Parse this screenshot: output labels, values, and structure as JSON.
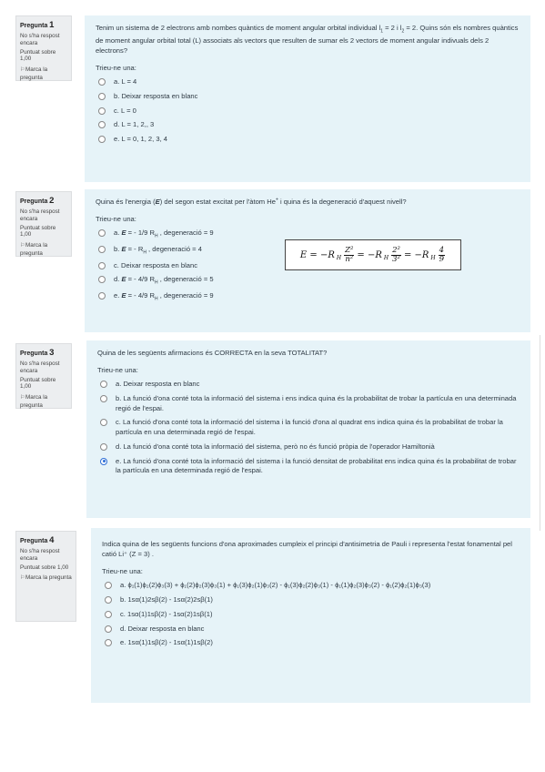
{
  "sidebar_common": {
    "state": "No s'ha respost encara",
    "score": "Puntuat sobre 1,00",
    "flag": "Marca la pregunta",
    "flag_icon": "flag-icon"
  },
  "questions": [
    {
      "label": "Pregunta",
      "number": "1",
      "text_parts": [
        "Tenim un sistema de 2 electrons amb nombes quàntics de moment angular orbital individual l",
        "1",
        " = 2 i l",
        "2",
        " = 2. Quins són els nombres quàntics de moment angular orbital total (L) associats als vectors que resulten de sumar els 2 vectors de moment angular indivuals dels 2 electrons?"
      ],
      "prompt": "Trieu-ne una:",
      "options": [
        "a. L = 4",
        "b. Deixar resposta en blanc",
        "c. L = 0",
        "d. L = 1, 2,, 3",
        "e. L = 0, 1, 2, 3, 4"
      ],
      "selected": null
    },
    {
      "label": "Pregunta",
      "number": "2",
      "text_parts": [
        "Quina és l'energia (",
        "E",
        ") del segon estat excitat per l'àtom He",
        "+",
        " i quina és la degeneració d'aquest nivell?"
      ],
      "prompt": "Trieu-ne una:",
      "options": [
        [
          "a. ",
          "E",
          " = - 1/9 R",
          "H",
          " , degeneració = 9"
        ],
        [
          "b. ",
          "E",
          " = - R",
          "H",
          " , degeneració = 4"
        ],
        [
          "c. Deixar resposta en blanc"
        ],
        [
          "d. ",
          "E",
          " = - 4/9 R",
          "H",
          " , degeneració = 5"
        ],
        [
          "e. ",
          "E",
          " = - 4/9 R",
          "H",
          " , degeneració = 9"
        ]
      ],
      "selected": null,
      "formula": {
        "lhs": "E = −R",
        "sub": "H",
        "f1_num": "Z²",
        "f1_den": "n²",
        "mid": "= −R",
        "f2_num": "2²",
        "f2_den": "3²",
        "f3_num": "4",
        "f3_den": "9"
      }
    },
    {
      "label": "Pregunta",
      "number": "3",
      "text": "Quina de les següents afirmacions és CORRECTA en la seva TOTALITAT?",
      "prompt": "Trieu-ne una:",
      "options": [
        "a. Deixar resposta en blanc",
        "b. La funció d'ona conté tota la informació del sistema i ens indica quina és la probabilitat de trobar la partícula en una determinada regió de l'espai.",
        "c. La funció d'ona conté tota la informació del sistema i la funció d'ona al quadrat ens indica quina és la probabilitat de trobar la partícula en una determinada regió de l'espai.",
        "d. La funció d'ona conté tota la informació del sistema, però no és funció pròpia de l'operador Hamiltonià",
        "e. La funció d'ona conté tota la informació del sistema i la funció densitat de probabilitat ens indica quina és la probabilitat de trobar la partícula en una determinada regió de l'espai."
      ],
      "selected": 4
    },
    {
      "label": "Pregunta",
      "number": "4",
      "text": "Indica quina de les següents funcions d'ona aproximades cumpleix el principi d'antisimetria de Pauli i representa l'estat fonamental pel catió Li⁺ (Z = 3) .",
      "prompt": "Trieu-ne una:",
      "options": [
        "a. ϕ₁(1)ϕ₂(2)ϕ₃(3) + ϕ₁(2)ϕ₂(3)ϕ₃(1) + ϕ₁(3)ϕ₂(1)ϕ₃(2) - ϕ₁(3)ϕ₂(2)ϕ₃(1) - ϕ₁(1)ϕ₂(3)ϕ₃(2) - ϕ₁(2)ϕ₂(1)ϕ₃(3)",
        "b. 1sα(1)2sβ(2) - 1sα(2)2sβ(1)",
        "c. 1sα(1)1sβ(2) - 1sα(2)1sβ(1)",
        "d. Deixar resposta en blanc",
        "e. 1sα(1)1sβ(2) - 1sα(1)1sβ(2)"
      ],
      "selected": null
    }
  ],
  "colors": {
    "content_bg": "#e6f3f8",
    "info_bg": "#eceef0",
    "selected_radio": "#2f6fd6"
  }
}
